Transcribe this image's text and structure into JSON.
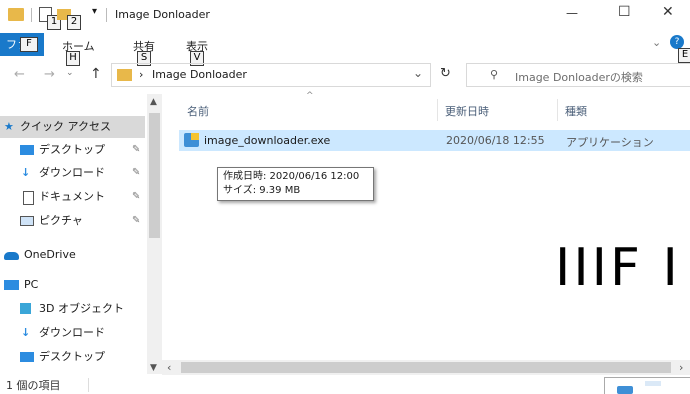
{
  "window": {
    "title": "Image Donloader",
    "minimize_glyph": "—",
    "maximize_glyph": "☐",
    "close_glyph": "✕",
    "qat_keytips": [
      "1",
      "2"
    ]
  },
  "ribbon": {
    "file_tab": "ファイル",
    "file_keytip": "F",
    "tabs": [
      {
        "label": "ホーム",
        "keytip": "H"
      },
      {
        "label": "共有",
        "keytip": "S"
      },
      {
        "label": "表示",
        "keytip": "V"
      }
    ],
    "help_keytip": "E"
  },
  "navigation": {
    "back_glyph": "←",
    "forward_glyph": "→",
    "up_glyph": "↑",
    "breadcrumb": "Image Donloader",
    "search_placeholder": "Image Donloaderの検索"
  },
  "nav_pane": {
    "quick_access": "クイック アクセス",
    "items": [
      {
        "label": "デスクトップ",
        "pinned": true
      },
      {
        "label": "ダウンロード",
        "pinned": true
      },
      {
        "label": "ドキュメント",
        "pinned": true
      },
      {
        "label": "ピクチャ",
        "pinned": true
      },
      {
        "label": "OneDrive",
        "pinned": false
      },
      {
        "label": "PC",
        "pinned": false
      },
      {
        "label": "3D オブジェクト",
        "pinned": false
      },
      {
        "label": "ダウンロード",
        "pinned": false
      },
      {
        "label": "デスクトップ",
        "pinned": false
      }
    ]
  },
  "columns": {
    "name": "名前",
    "modified": "更新日時",
    "type": "種類"
  },
  "files": [
    {
      "name": "image_downloader.exe",
      "modified": "2020/06/18 12:55",
      "type": "アプリケーション"
    }
  ],
  "tooltip": {
    "line1": "作成日時: 2020/06/16 12:00",
    "line2": "サイズ: 9.39 MB"
  },
  "status_bar": {
    "item_count": "1 個の項目"
  },
  "background_text": "IIIF I",
  "colors": {
    "accent": "#1979ca",
    "selection": "#cce8ff"
  }
}
